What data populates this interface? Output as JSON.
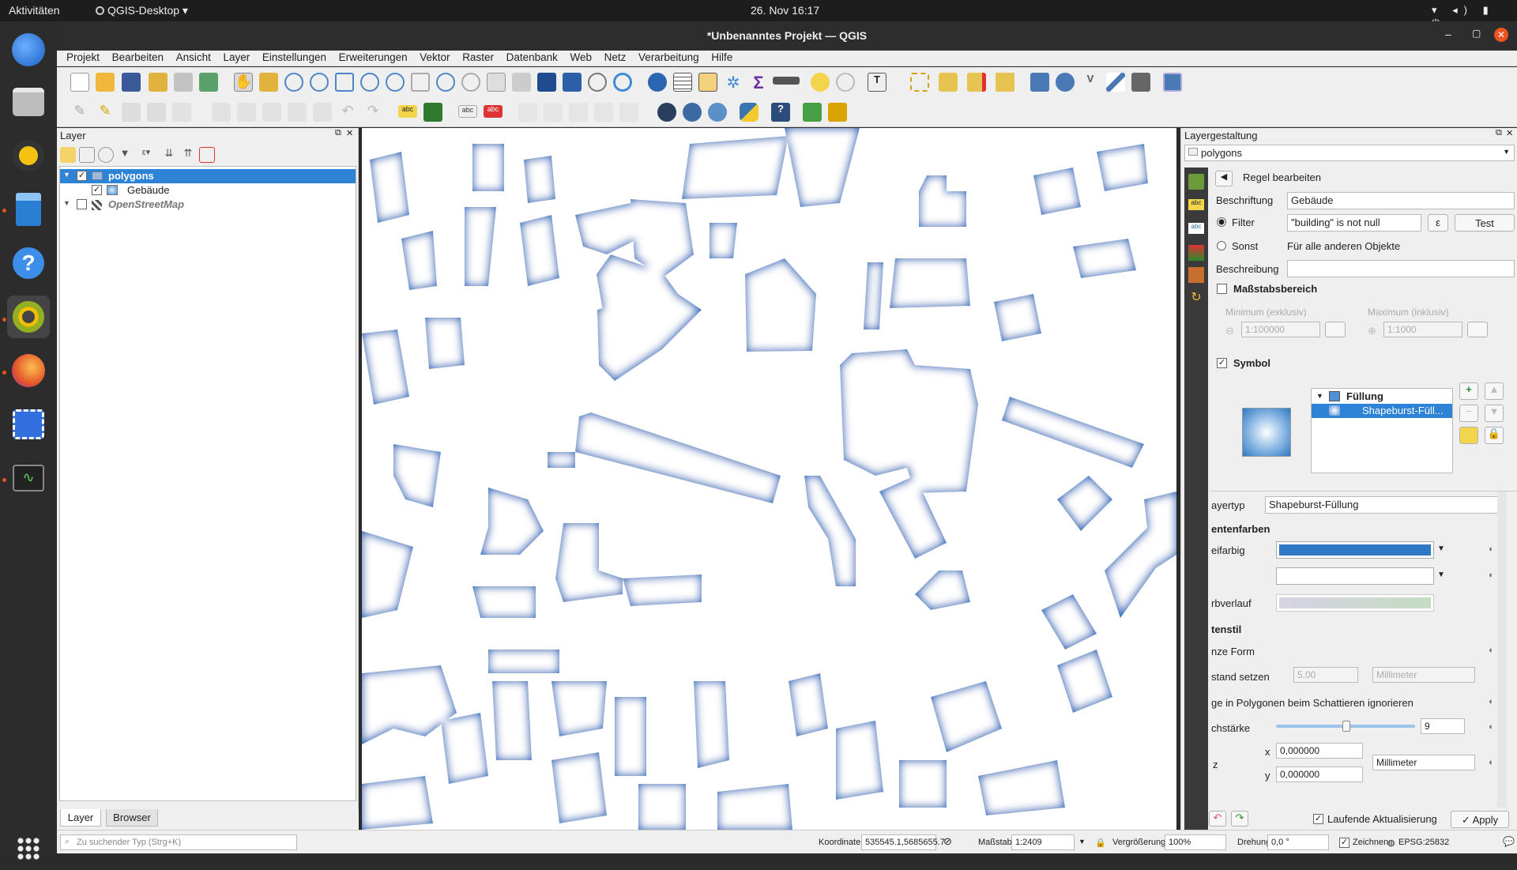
{
  "topbar": {
    "activities": "Aktivitäten",
    "app_menu": "QGIS-Desktop",
    "clock": "26. Nov  16:17"
  },
  "window": {
    "title": "*Unbenanntes Projekt — QGIS"
  },
  "menu": [
    "Projekt",
    "Bearbeiten",
    "Ansicht",
    "Layer",
    "Einstellungen",
    "Erweiterungen",
    "Vektor",
    "Raster",
    "Datenbank",
    "Web",
    "Netz",
    "Verarbeitung",
    "Hilfe"
  ],
  "layer_panel": {
    "title": "Layer",
    "layers": [
      {
        "name": "polygons",
        "checked": true,
        "selected": true
      },
      {
        "name": "Gebäude",
        "checked": true
      },
      {
        "name": "OpenStreetMap",
        "checked": false
      }
    ],
    "tabs": [
      "Layer",
      "Browser"
    ],
    "search_placeholder": "Zu suchender Typ (Strg+K)"
  },
  "style_panel": {
    "title": "Layergestaltung",
    "layer_select": "polygons",
    "edit_rule": "Regel bearbeiten",
    "label_caption": "Beschriftung",
    "caption_value": "Gebäude",
    "filter_label": "Filter",
    "filter_value": "\"building\" is not null",
    "epsilon": "ε",
    "test_button": "Test",
    "else_label": "Sonst",
    "else_text": "Für alle anderen Objekte",
    "description_label": "Beschreibung",
    "scale_range": "Maßstabsbereich",
    "min_label": "Minimum (exklusiv)",
    "max_label": "Maximum (inklusiv)",
    "min_value": "1:100000",
    "max_value": "1:1000",
    "symbol_label": "Symbol",
    "tree_fill": "Füllung",
    "tree_shapeburst": "Shapeburst-Füll...",
    "layer_type_label": "ayertyp",
    "layer_type_value": "Shapeburst-Füllung",
    "gradient_colors": "entenfarben",
    "two_color": "eifarbig",
    "ramp": "rbverlauf",
    "shading": "tenstil",
    "whole_shape": "nze Form",
    "set_distance": "stand setzen",
    "distance_value": "5,00",
    "unit_mm": "Millimeter",
    "ignore_rings": "ge in Polygonen beim Schattieren ignorieren",
    "blur_strength": "chstärke",
    "blur_value": "9",
    "offset_label": "z",
    "x_label": "x",
    "y_label": "y",
    "x_value": "0,000000",
    "y_value": "0,000000",
    "offset_unit": "Millimeter",
    "live_update": "Laufende Aktualisierung",
    "apply": "Apply",
    "colors": {
      "primary": "#2e78c4",
      "secondary": "#ffffff"
    }
  },
  "statusbar": {
    "coordinate_label": "Koordinate",
    "coordinate_value": "535545.1,5685655.7",
    "scale_label": "Maßstab",
    "scale_value": "1:2409",
    "magnifier_label": "Vergrößerung",
    "magnifier_value": "100%",
    "rotation_label": "Drehung",
    "rotation_value": "0,0 °",
    "render_label": "Zeichnen",
    "crs": "EPSG:25832"
  }
}
